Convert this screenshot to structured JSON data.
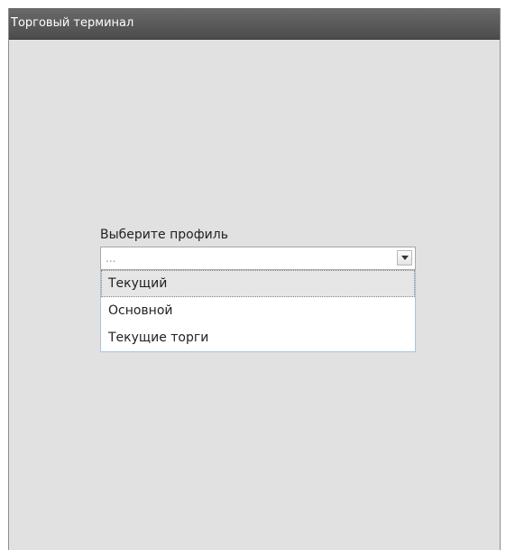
{
  "window": {
    "title": "Торговый терминал"
  },
  "profile_selector": {
    "label": "Выберите профиль",
    "selected_value": "...",
    "arrow_icon": "chevron-down-icon",
    "options": [
      {
        "label": "Текущий",
        "highlighted": true
      },
      {
        "label": "Основной",
        "highlighted": false
      },
      {
        "label": "Текущие торги",
        "highlighted": false
      }
    ]
  },
  "colors": {
    "titlebar": "#555555",
    "window_background": "#e1e1e1",
    "highlight": "#e6e6e6"
  }
}
